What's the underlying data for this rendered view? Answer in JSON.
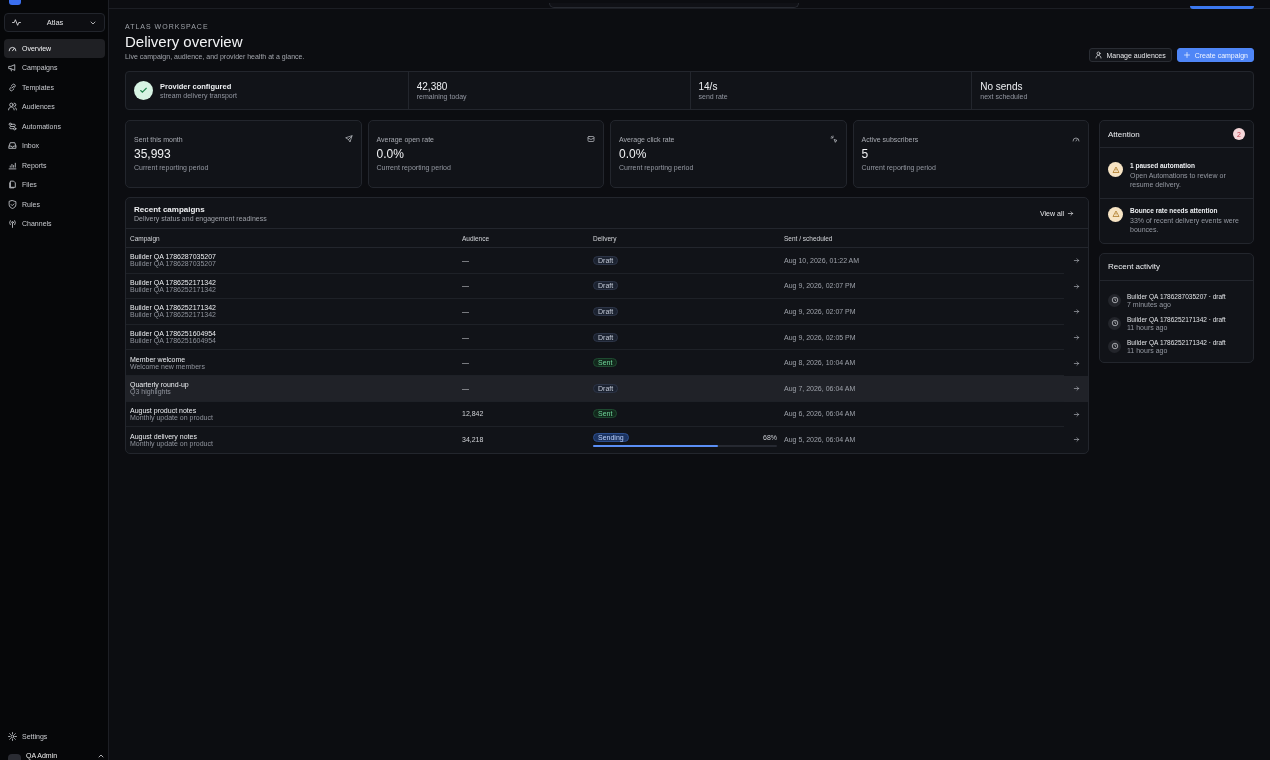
{
  "workspace_switcher": {
    "label": "Atlas"
  },
  "sidebar": {
    "items": [
      {
        "label": "Overview",
        "selected": true
      },
      {
        "label": "Campaigns",
        "selected": false
      },
      {
        "label": "Templates",
        "selected": false
      },
      {
        "label": "Audiences",
        "selected": false
      },
      {
        "label": "Automations",
        "selected": false
      },
      {
        "label": "Inbox",
        "selected": false
      },
      {
        "label": "Reports",
        "selected": false
      },
      {
        "label": "Files",
        "selected": false
      },
      {
        "label": "Rules",
        "selected": false
      },
      {
        "label": "Channels",
        "selected": false
      }
    ],
    "settings": "Settings",
    "user": "QA Admin"
  },
  "header": {
    "eyebrow": "ATLAS WORKSPACE",
    "title": "Delivery overview",
    "subtitle": "Live campaign, audience, and provider health at a glance.",
    "buttons": [
      {
        "label": "Manage audiences",
        "kind": "secondary"
      },
      {
        "label": "Create campaign",
        "kind": "primary"
      }
    ]
  },
  "provider_strip": [
    {
      "value": "Provider configured",
      "caption": "stream delivery transport",
      "kind": "status"
    },
    {
      "value": "42,380",
      "caption": "remaining today",
      "kind": "metric"
    },
    {
      "value": "14/s",
      "caption": "send rate",
      "kind": "metric"
    },
    {
      "value": "No sends",
      "caption": "next scheduled",
      "kind": "metric"
    }
  ],
  "stats": [
    {
      "label": "Sent this month",
      "value": "35,993",
      "caption": "Current reporting period"
    },
    {
      "label": "Average open rate",
      "value": "0.0%",
      "caption": "Current reporting period"
    },
    {
      "label": "Average click rate",
      "value": "0.0%",
      "caption": "Current reporting period"
    },
    {
      "label": "Active subscribers",
      "value": "5",
      "caption": "Current reporting period"
    }
  ],
  "recent_campaigns": {
    "title": "Recent campaigns",
    "subtitle": "Delivery status and engagement readiness",
    "link": "View all",
    "columns": [
      "Campaign",
      "Audience",
      "Delivery",
      "Sent / scheduled"
    ],
    "rows": [
      {
        "name": "Builder QA 1786287035207",
        "detail": "Builder QA 1786287035207",
        "audience": "—",
        "status": "Draft",
        "kind": "draft",
        "time": "Aug 10, 2026, 01:22 AM",
        "selected": false
      },
      {
        "name": "Builder QA 1786252171342",
        "detail": "Builder QA 1786252171342",
        "audience": "—",
        "status": "Draft",
        "kind": "draft",
        "time": "Aug 9, 2026, 02:07 PM",
        "selected": false
      },
      {
        "name": "Builder QA 1786252171342",
        "detail": "Builder QA 1786252171342",
        "audience": "—",
        "status": "Draft",
        "kind": "draft",
        "time": "Aug 9, 2026, 02:07 PM",
        "selected": false
      },
      {
        "name": "Builder QA 1786251604954",
        "detail": "Builder QA 1786251604954",
        "audience": "—",
        "status": "Draft",
        "kind": "draft",
        "time": "Aug 9, 2026, 02:05 PM",
        "selected": false
      },
      {
        "name": "Member welcome",
        "detail": "Welcome new members",
        "audience": "—",
        "status": "Sent",
        "kind": "sent",
        "time": "Aug 8, 2026, 10:04 AM",
        "selected": false
      },
      {
        "name": "Quarterly round-up",
        "detail": "Q3 highlights",
        "audience": "—",
        "status": "Draft",
        "kind": "draft",
        "time": "Aug 7, 2026, 06:04 AM",
        "selected": true
      },
      {
        "name": "August product notes",
        "detail": "Monthly update on product",
        "audience": "12,842",
        "status": "Sent",
        "kind": "sent",
        "time": "Aug 6, 2026, 06:04 AM",
        "selected": false
      },
      {
        "name": "August delivery notes",
        "detail": "Monthly update on product",
        "audience": "34,218",
        "status": "Sending",
        "kind": "sending",
        "level": 0.68,
        "percent": "68%",
        "time": "Aug 5, 2026, 06:04 AM",
        "selected": false
      }
    ]
  },
  "attention": {
    "title": "Attention",
    "count": "2",
    "items": [
      {
        "title": "1 paused automation",
        "text": "Open Automations to review or resume delivery."
      },
      {
        "title": "Bounce rate needs attention",
        "text": "33% of recent delivery events were bounces."
      }
    ]
  },
  "recent_activity": {
    "title": "Recent activity",
    "items": [
      {
        "text": "Builder QA 1786287035207 · draft",
        "time": "7 minutes ago"
      },
      {
        "text": "Builder QA 1786252171342 · draft",
        "time": "11 hours ago"
      },
      {
        "text": "Builder QA 1786252171342 · draft",
        "time": "11 hours ago"
      }
    ]
  }
}
